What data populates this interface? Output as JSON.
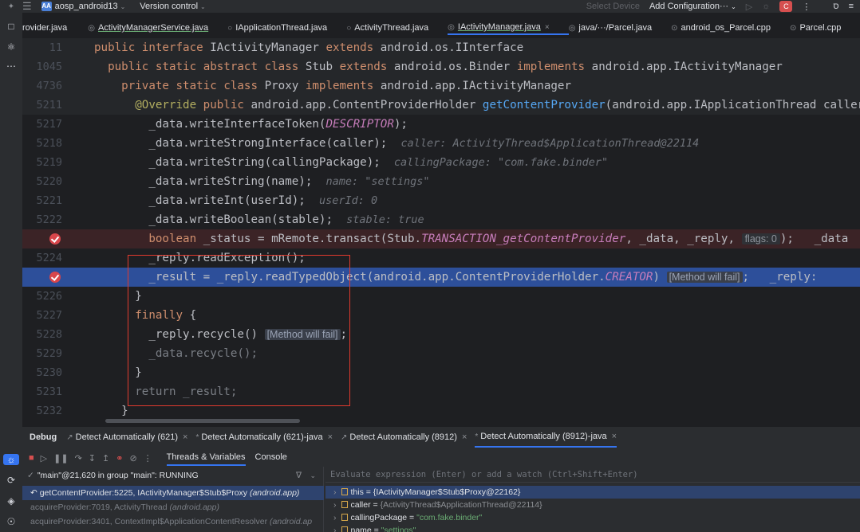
{
  "topbar": {
    "project_badge": "AA",
    "project_name": "aosp_android13",
    "vcs": "Version control",
    "device": "Select Device",
    "config": "Add Configuration···",
    "run_badge": "C"
  },
  "tabs": [
    {
      "label": "rovider.java",
      "active": false
    },
    {
      "label": "ActivityManagerService.java",
      "active": false
    },
    {
      "label": "IApplicationThread.java",
      "active": false
    },
    {
      "label": "ActivityThread.java",
      "active": false
    },
    {
      "label": "IActivityManager.java",
      "active": true
    },
    {
      "label": "java/···/Parcel.java",
      "active": false
    },
    {
      "label": "android_os_Parcel.cpp",
      "active": false
    },
    {
      "label": "Parcel.cpp",
      "active": false
    }
  ],
  "editor": {
    "lines": [
      {
        "num": "11",
        "code": "public interface IActivityManager extends android.os.IInterface"
      },
      {
        "num": "1045",
        "code": "  public static abstract class Stub extends android.os.Binder implements android.app.IActivityManager"
      },
      {
        "num": "4736",
        "code": "    private static class Proxy implements android.app.IActivityManager"
      },
      {
        "num": "5211",
        "code": "      @Override public android.app.ContentProviderHolder getContentProvider(android.app.IApplicationThread caller"
      },
      {
        "num": "5217",
        "code": "        _data.writeInterfaceToken(DESCRIPTOR);"
      },
      {
        "num": "5218",
        "code": "        _data.writeStrongInterface(caller);",
        "hint": "caller: ActivityThread$ApplicationThread@22114"
      },
      {
        "num": "5219",
        "code": "        _data.writeString(callingPackage);",
        "hint": "callingPackage: \"com.fake.binder\""
      },
      {
        "num": "5220",
        "code": "        _data.writeString(name);",
        "hint": "name: \"settings\""
      },
      {
        "num": "5221",
        "code": "        _data.writeInt(userId);",
        "hint": "userId: 0"
      },
      {
        "num": "5222",
        "code": "        _data.writeBoolean(stable);",
        "hint": "stable: true"
      },
      {
        "num": "",
        "code": "        boolean _status = mRemote.transact(Stub.TRANSACTION_getContentProvider, _data, _reply,",
        "pill": "flags: 0",
        "tail": ");   _data"
      },
      {
        "num": "5224",
        "code": "        _reply.readException();"
      },
      {
        "num": "",
        "code": "        _result = _reply.readTypedObject(android.app.ContentProviderHolder.CREATOR)",
        "pill": "[Method will fail]",
        "tail": ";   _reply:"
      },
      {
        "num": "5226",
        "code": "      }"
      },
      {
        "num": "5227",
        "code": "      finally {"
      },
      {
        "num": "5228",
        "code": "        _reply.recycle()",
        "pill": "[Method will fail]",
        "tail": ";"
      },
      {
        "num": "5229",
        "code": "        _data.recycle();"
      },
      {
        "num": "5230",
        "code": "      }"
      },
      {
        "num": "5231",
        "code": "      return _result;"
      },
      {
        "num": "5232",
        "code": "    }"
      }
    ]
  },
  "debug": {
    "title": "Debug",
    "sessions": [
      {
        "label": "Detect Automatically (621)",
        "active": false
      },
      {
        "label": "Detect Automatically (621)-java",
        "active": false
      },
      {
        "label": "Detect Automatically (8912)",
        "active": false
      },
      {
        "label": "Detect Automatically (8912)-java",
        "active": true
      }
    ],
    "subtabs": [
      "Threads & Variables",
      "Console"
    ],
    "thread": "\"main\"@21,620 in group \"main\": RUNNING",
    "frames": [
      {
        "text": "getContentProvider:5225, IActivityManager$Stub$Proxy",
        "pkg": "(android.app)",
        "selected": true
      },
      {
        "text": "acquireProvider:7019, ActivityThread",
        "pkg": "(android.app)",
        "selected": false
      },
      {
        "text": "acquireProvider:3401, ContextImpl$ApplicationContentResolver",
        "pkg": "(android.ap",
        "selected": false
      }
    ],
    "watch_placeholder": "Evaluate expression (Enter) or add a watch (Ctrl+Shift+Enter)",
    "variables": [
      {
        "name": "this",
        "value": "{IActivityManager$Stub$Proxy@22162}",
        "selected": true,
        "string": false
      },
      {
        "name": "caller",
        "value": "{ActivityThread$ApplicationThread@22114}",
        "selected": false,
        "string": false
      },
      {
        "name": "callingPackage",
        "value": "\"com.fake.binder\"",
        "selected": false,
        "string": true
      },
      {
        "name": "name",
        "value": "\"settings\"",
        "selected": false,
        "string": true
      }
    ]
  }
}
